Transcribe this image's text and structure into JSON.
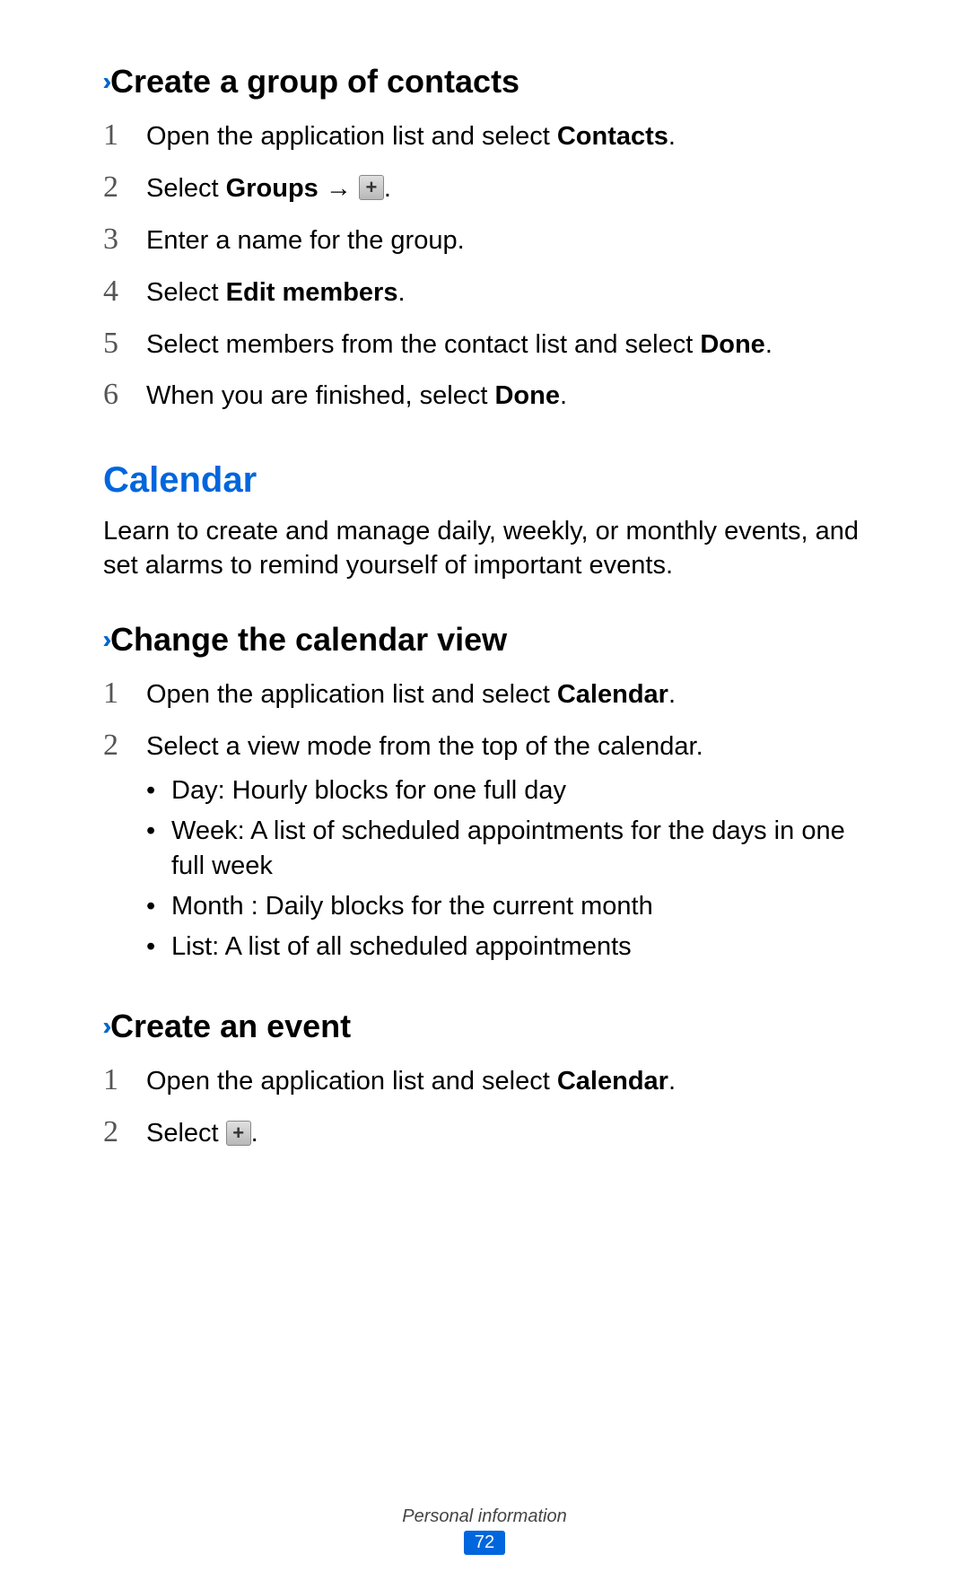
{
  "section1": {
    "heading": "Create a group of contacts",
    "steps": [
      {
        "num": "1",
        "parts": [
          "Open the application list and select ",
          {
            "bold": "Contacts"
          },
          "."
        ]
      },
      {
        "num": "2",
        "parts": [
          "Select ",
          {
            "bold": "Groups"
          },
          " → ",
          {
            "icon": "plus"
          },
          "."
        ]
      },
      {
        "num": "3",
        "parts": [
          "Enter a name for the group."
        ]
      },
      {
        "num": "4",
        "parts": [
          "Select ",
          {
            "bold": "Edit members"
          },
          "."
        ]
      },
      {
        "num": "5",
        "parts": [
          "Select members from the contact list and select ",
          {
            "bold": "Done"
          },
          "."
        ]
      },
      {
        "num": "6",
        "parts": [
          "When you are finished, select ",
          {
            "bold": "Done"
          },
          "."
        ]
      }
    ]
  },
  "main_heading": "Calendar",
  "intro": "Learn to create and manage daily, weekly, or monthly events, and set alarms to remind yourself of important events.",
  "section2": {
    "heading": "Change the calendar view",
    "steps": [
      {
        "num": "1",
        "parts": [
          "Open the application list and select ",
          {
            "bold": "Calendar"
          },
          "."
        ]
      },
      {
        "num": "2",
        "parts": [
          "Select a view mode from the top of the calendar."
        ],
        "bullets": [
          "Day: Hourly blocks for one full day",
          "Week: A list of scheduled appointments for the days in one full week",
          "Month : Daily blocks for the current month",
          "List: A list of all scheduled appointments"
        ]
      }
    ]
  },
  "section3": {
    "heading": "Create an event",
    "steps": [
      {
        "num": "1",
        "parts": [
          "Open the application list and select ",
          {
            "bold": "Calendar"
          },
          "."
        ]
      },
      {
        "num": "2",
        "parts": [
          "Select ",
          {
            "icon": "plus"
          },
          "."
        ]
      }
    ]
  },
  "footer": {
    "label": "Personal information",
    "page": "72"
  }
}
